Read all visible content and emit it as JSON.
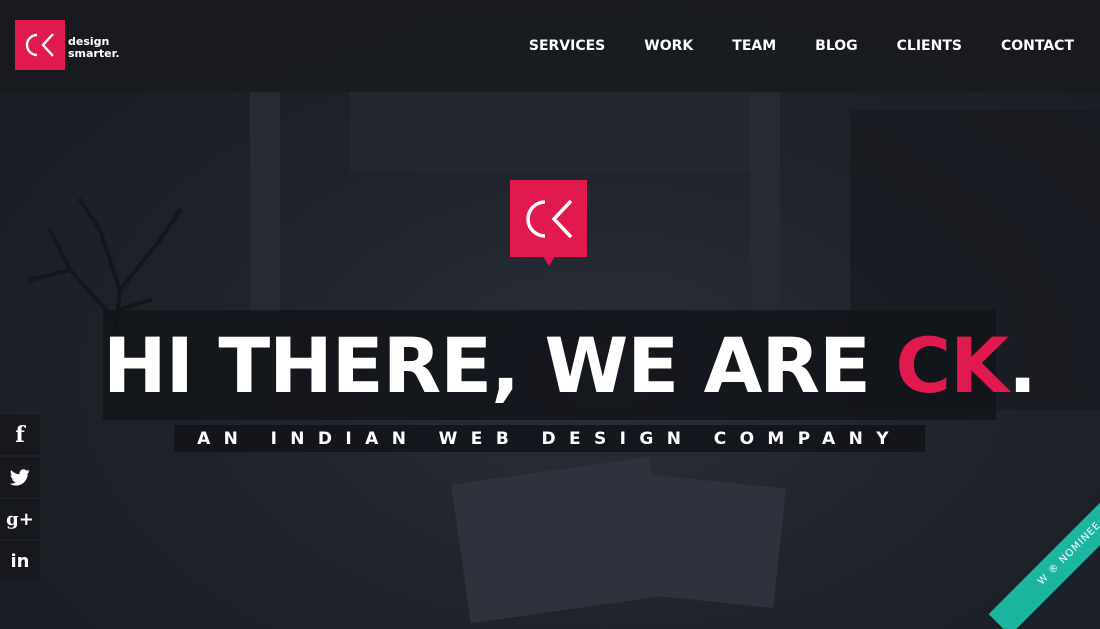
{
  "brand": {
    "logo_text": "CK",
    "tagline_line1": "design",
    "tagline_line2": "smarter.",
    "accent_color": "#e0194f"
  },
  "nav": {
    "items": [
      {
        "label": "SERVICES"
      },
      {
        "label": "WORK"
      },
      {
        "label": "TEAM"
      },
      {
        "label": "BLOG"
      },
      {
        "label": "CLIENTS"
      },
      {
        "label": "CONTACT"
      }
    ]
  },
  "hero": {
    "headline_prefix": "HI THERE, WE ARE ",
    "headline_accent": "CK",
    "headline_suffix": ".",
    "subheadline": "AN INDIAN WEB DESIGN COMPANY"
  },
  "social": {
    "icons": [
      "facebook-icon",
      "twitter-icon",
      "google-plus-icon",
      "linkedin-icon"
    ],
    "facebook_glyph": "f",
    "google_plus_glyph": "g+",
    "linkedin_glyph": "in"
  },
  "ribbon": {
    "label": "W ® NOMINEE",
    "color": "#1bb5a0"
  }
}
